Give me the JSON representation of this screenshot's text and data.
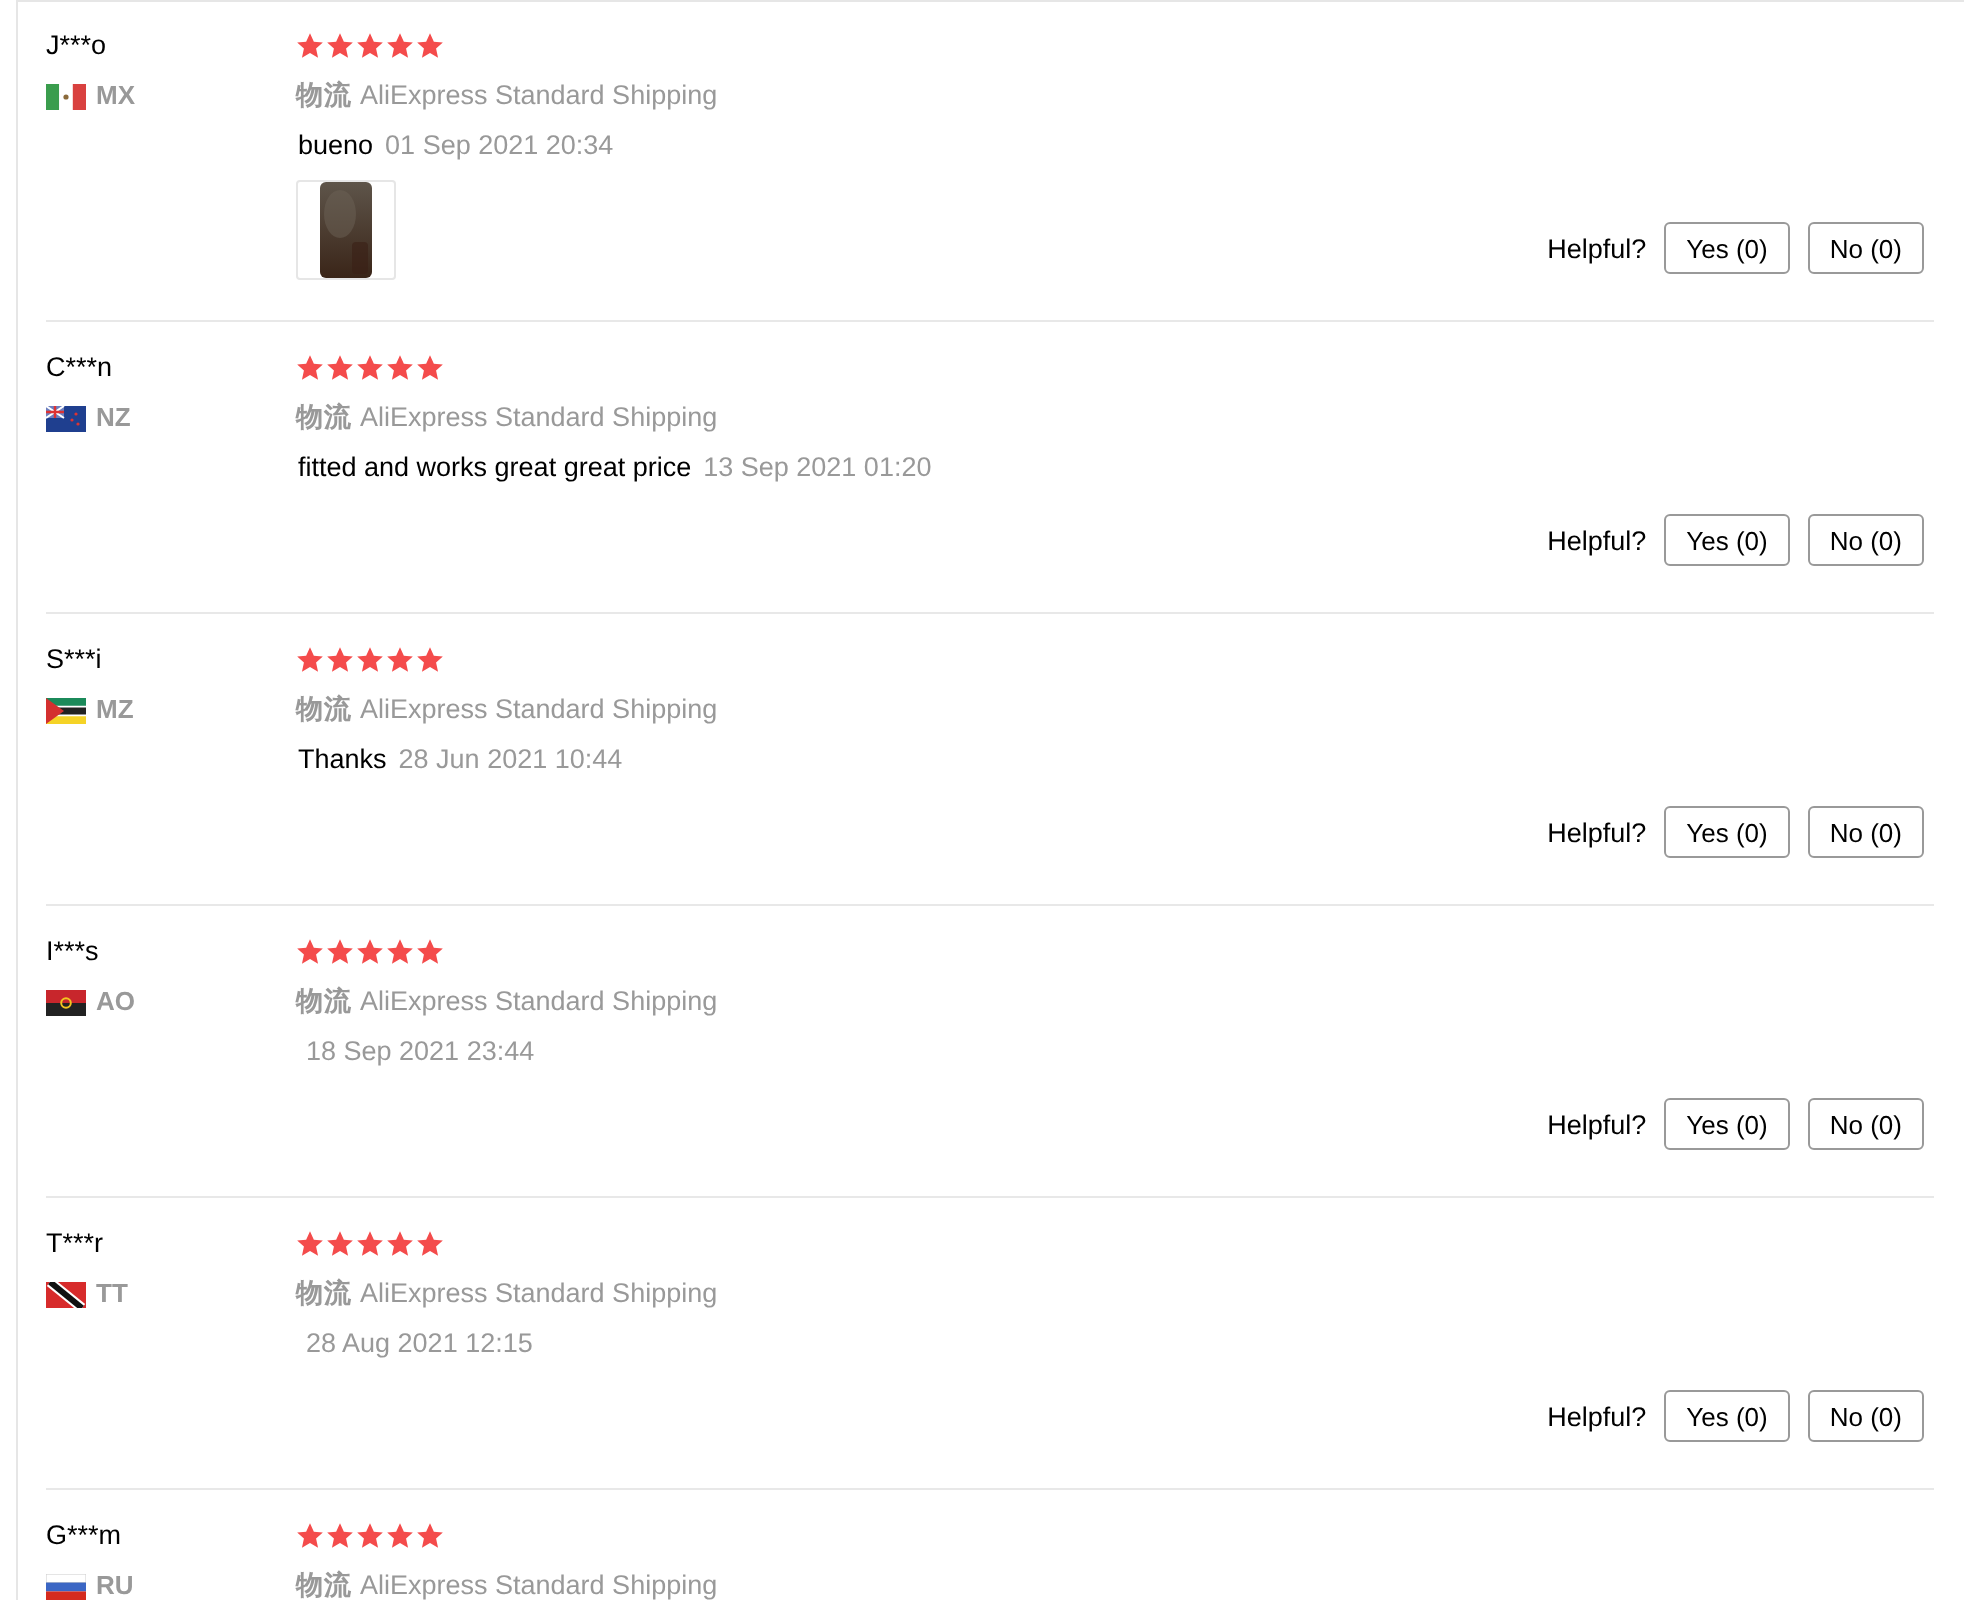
{
  "reviews": [
    {
      "name": "J***o",
      "flag": {
        "kind": "mexico"
      },
      "country": "MX",
      "stars": 5,
      "shipping_label": "物流",
      "shipping": "AliExpress Standard Shipping",
      "comment": "bueno",
      "date": "01 Sep 2021 20:34",
      "photos": [
        {
          "kind": "picture"
        }
      ],
      "helpful_label": "Helpful?",
      "yes": "Yes (0)",
      "no": "No (0)"
    },
    {
      "name": "C***n",
      "flag": {
        "kind": "new-zealand"
      },
      "country": "NZ",
      "stars": 5,
      "shipping_label": "物流",
      "shipping": "AliExpress Standard Shipping",
      "comment": "fitted and works great great price",
      "date": "13 Sep 2021 01:20",
      "helpful_label": "Helpful?",
      "yes": "Yes (0)",
      "no": "No (0)"
    },
    {
      "name": "S***i",
      "flag": {
        "kind": "mozambique"
      },
      "country": "MZ",
      "stars": 5,
      "shipping_label": "物流",
      "shipping": "AliExpress Standard Shipping",
      "comment": "Thanks",
      "date": "28 Jun 2021 10:44",
      "helpful_label": "Helpful?",
      "yes": "Yes (0)",
      "no": "No (0)"
    },
    {
      "name": "I***s",
      "flag": {
        "kind": "angola"
      },
      "country": "AO",
      "stars": 5,
      "shipping_label": "物流",
      "shipping": "AliExpress Standard Shipping",
      "date": "18 Sep 2021 23:44",
      "helpful_label": "Helpful?",
      "yes": "Yes (0)",
      "no": "No (0)"
    },
    {
      "name": "T***r",
      "flag": {
        "kind": "trinidad"
      },
      "country": "TT",
      "stars": 5,
      "shipping_label": "物流",
      "shipping": "AliExpress Standard Shipping",
      "date": "28 Aug 2021 12:15",
      "helpful_label": "Helpful?",
      "yes": "Yes (0)",
      "no": "No (0)"
    },
    {
      "name": "G***m",
      "flag": {
        "kind": "russia"
      },
      "country": "RU",
      "stars": 5,
      "shipping_label": "物流",
      "shipping": "AliExpress Standard Shipping"
    }
  ]
}
